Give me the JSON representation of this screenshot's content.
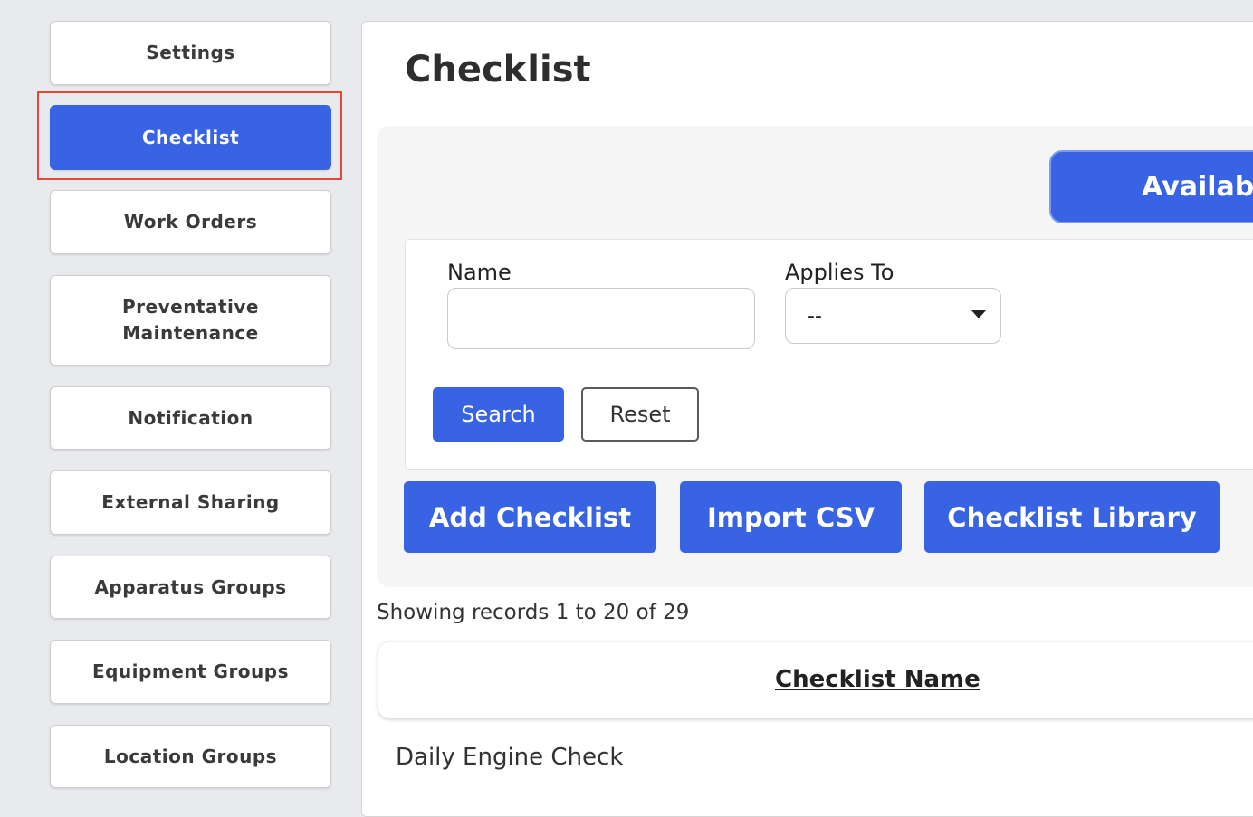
{
  "sidebar": {
    "items": [
      {
        "label": "Settings"
      },
      {
        "label": "Checklist"
      },
      {
        "label": "Work Orders"
      },
      {
        "label": "Preventative Maintenance"
      },
      {
        "label": "Notification"
      },
      {
        "label": "External Sharing"
      },
      {
        "label": "Apparatus Groups"
      },
      {
        "label": "Equipment Groups"
      },
      {
        "label": "Location Groups"
      }
    ],
    "active_index": 1
  },
  "main": {
    "title": "Checklist",
    "available_button": "Available",
    "filters": {
      "name_label": "Name",
      "name_value": "",
      "applies_to_label": "Applies To",
      "applies_to_value": "--",
      "search_button": "Search",
      "reset_button": "Reset"
    },
    "actions": {
      "add_checklist": "Add Checklist",
      "import_csv": "Import CSV",
      "checklist_library": "Checklist Library"
    },
    "records_text": "Showing records 1 to 20 of 29",
    "table": {
      "column_header": "Checklist Name",
      "rows": [
        {
          "name": "Daily Engine Check"
        }
      ]
    }
  },
  "colors": {
    "accent": "#3864e3",
    "highlight": "#e4493c",
    "background": "#e9eaed"
  }
}
